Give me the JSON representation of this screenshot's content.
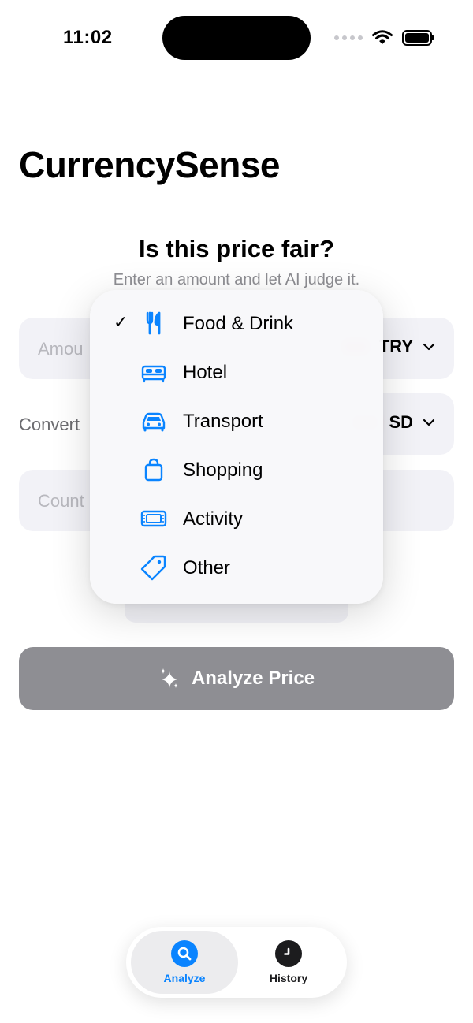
{
  "status_bar": {
    "time": "11:02"
  },
  "app": {
    "title": "CurrencySense"
  },
  "hero": {
    "headline": "Is this price fair?",
    "subline": "Enter an amount and let AI judge it."
  },
  "form": {
    "amount_placeholder": "Amou",
    "amount_currency": "TRY",
    "convert_label": "Convert",
    "convert_currency": "SD",
    "country_placeholder": "Count"
  },
  "category_menu": {
    "selected": "Food & Drink",
    "items": [
      {
        "label": "Food & Drink",
        "icon": "fork-knife-icon",
        "checked": true
      },
      {
        "label": "Hotel",
        "icon": "bed-icon",
        "checked": false
      },
      {
        "label": "Transport",
        "icon": "car-icon",
        "checked": false
      },
      {
        "label": "Shopping",
        "icon": "shopping-bag-icon",
        "checked": false
      },
      {
        "label": "Activity",
        "icon": "ticket-icon",
        "checked": false
      },
      {
        "label": "Other",
        "icon": "tag-icon",
        "checked": false
      }
    ],
    "check_mark": "✓"
  },
  "analyze_button": {
    "label": "Analyze Price",
    "icon": "sparkles-icon",
    "color": "#8e8e93"
  },
  "tab_bar": {
    "tabs": [
      {
        "label": "Analyze",
        "icon": "search-icon",
        "active": true
      },
      {
        "label": "History",
        "icon": "clock-icon",
        "active": false
      }
    ]
  },
  "colors": {
    "accent": "#0a84ff",
    "field_bg": "#f2f2f7",
    "disabled_button": "#8e8e93"
  }
}
